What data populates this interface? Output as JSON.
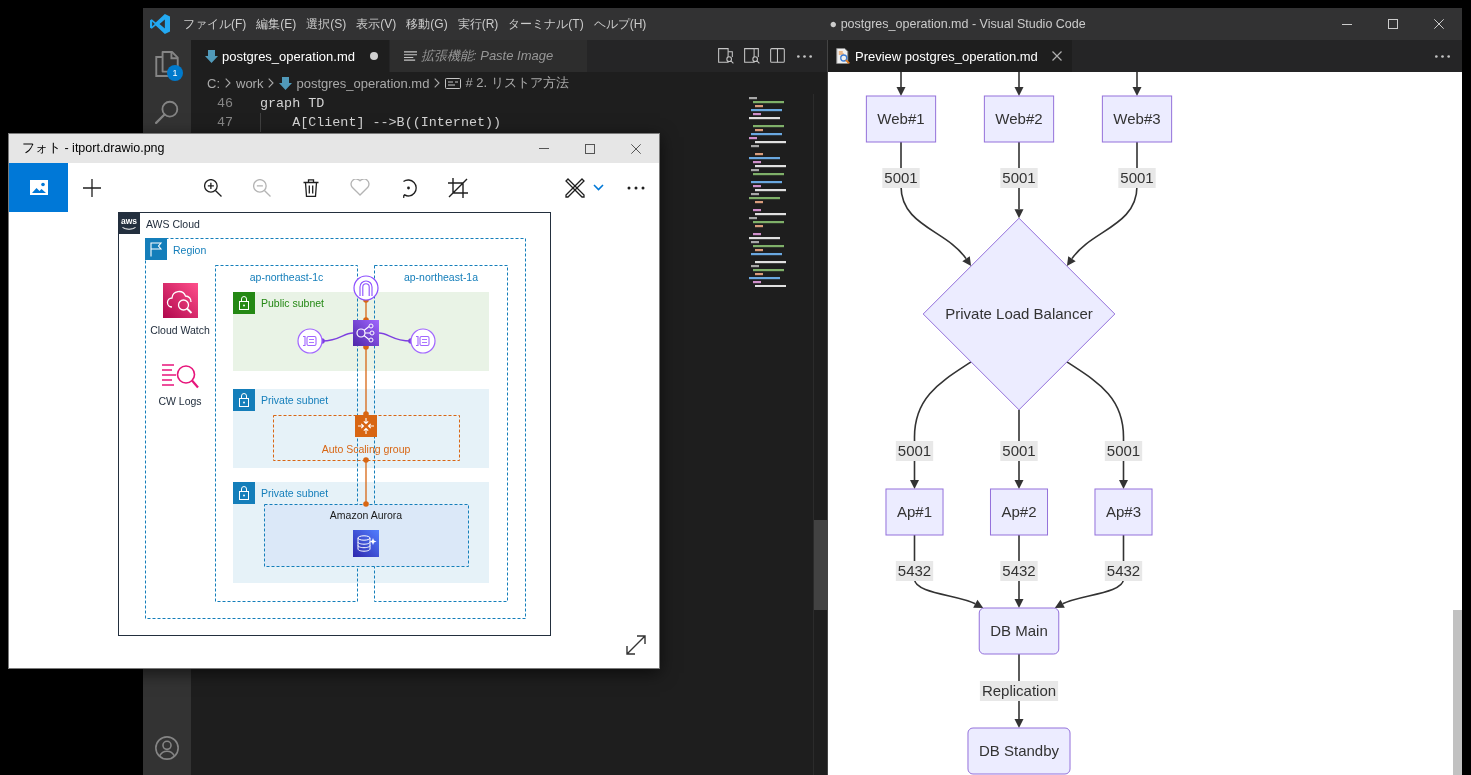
{
  "editor_window": {
    "title": "● postgres_operation.md - Visual Studio Code",
    "menu": [
      "ファイル(F)",
      "編集(E)",
      "選択(S)",
      "表示(V)",
      "移動(G)",
      "実行(R)",
      "ターミナル(T)",
      "ヘルプ(H)"
    ],
    "activity_bar": [
      {
        "kind": "explorer",
        "badge": "1"
      },
      {
        "kind": "search"
      },
      {
        "kind": "account"
      }
    ],
    "editor": {
      "tabs": [
        {
          "label": "postgres_operation.md",
          "kind": "markdown",
          "selected": true,
          "dirty": true,
          "preview": false
        },
        {
          "label": "拡張機能: Paste Image",
          "kind": "extension",
          "selected": false,
          "dirty": false,
          "preview": true
        }
      ],
      "breadcrumb": [
        {
          "label": "C:",
          "kind": "folder"
        },
        {
          "label": "work",
          "kind": "folder"
        },
        {
          "label": "postgres_operation.md",
          "kind": "file"
        },
        {
          "label": "# 2. リストア方法",
          "kind": "heading"
        }
      ],
      "lines": [
        {
          "number": "46",
          "text": "graph TD"
        },
        {
          "number": "47",
          "text": "    A[Client] -->B((Internet))"
        }
      ]
    },
    "preview": {
      "tab": {
        "label": "Preview postgres_operation.md",
        "selected": true
      },
      "flowchart": {
        "incoming_arrows": true,
        "levels": [
          {
            "nodes": [
              {
                "label": "Web#1",
                "kind": "rect"
              },
              {
                "label": "Web#2",
                "kind": "rect"
              },
              {
                "label": "Web#3",
                "kind": "rect"
              }
            ],
            "edge_labels": [
              "5001",
              "5001",
              "5001"
            ]
          },
          {
            "nodes": [
              {
                "label": "Private Load Balancer",
                "kind": "diamond"
              }
            ],
            "edge_labels": [
              "5001",
              "5001",
              "5001"
            ]
          },
          {
            "nodes": [
              {
                "label": "Ap#1",
                "kind": "rect"
              },
              {
                "label": "Ap#2",
                "kind": "rect"
              },
              {
                "label": "Ap#3",
                "kind": "rect"
              }
            ],
            "edge_labels": [
              "5432",
              "5432",
              "5432"
            ]
          },
          {
            "nodes": [
              {
                "label": "DB Main",
                "kind": "round"
              }
            ],
            "edge_labels": [
              "Replication"
            ]
          },
          {
            "nodes": [
              {
                "label": "DB Standby",
                "kind": "round"
              }
            ]
          }
        ]
      }
    }
  },
  "photo_viewer": {
    "title": "フォト - itport.drawio.png",
    "nav": [
      {
        "kind": "picture",
        "selected": true
      },
      {
        "kind": "add",
        "selected": false
      }
    ],
    "toolbar": [
      {
        "kind": "zoom-in",
        "disabled": false
      },
      {
        "kind": "zoom-out",
        "disabled": true
      },
      {
        "kind": "delete",
        "disabled": false
      },
      {
        "kind": "favorite",
        "disabled": true
      },
      {
        "kind": "rotate",
        "disabled": false
      },
      {
        "kind": "crop",
        "disabled": false
      },
      {
        "kind": "edit",
        "disabled": false
      },
      {
        "kind": "more",
        "disabled": false
      }
    ],
    "diagram": {
      "logo": "aws",
      "cloud_label": "AWS Cloud",
      "region_label": "Region",
      "zones": [
        "ap-northeast-1c",
        "ap-northeast-1a"
      ],
      "services": [
        {
          "kind": "monitoring",
          "label": "Cloud Watch"
        },
        {
          "kind": "logs",
          "label": "CW Logs"
        }
      ],
      "subnets": [
        {
          "kind": "public",
          "label": "Public subnet"
        },
        {
          "kind": "private",
          "label": "Private subnet"
        },
        {
          "kind": "private",
          "label": "Private subnet"
        }
      ],
      "groups": [
        {
          "kind": "autoscaling",
          "label": "Auto Scaling group"
        },
        {
          "kind": "database",
          "label": "Amazon Aurora"
        }
      ]
    }
  }
}
